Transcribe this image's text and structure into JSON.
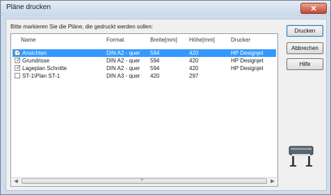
{
  "window": {
    "title": "Pläne drucken",
    "close_glyph": "✕"
  },
  "prompt": "Bitte markieren Sie die Pläne, die gedruckt werden sollen:",
  "columns": {
    "name": "Name",
    "format": "Format",
    "width": "Breite[mm]",
    "height": "Höhe[mm]",
    "printer": "Drucker"
  },
  "rows": [
    {
      "checked": true,
      "selected": true,
      "name": "Ansichten",
      "format": "DIN A2 - quer",
      "width": "594",
      "height": "420",
      "printer": "HP Designjet"
    },
    {
      "checked": true,
      "selected": false,
      "name": "Grundrisse",
      "format": "DIN A2 - quer",
      "width": "594",
      "height": "420",
      "printer": "HP Designjet"
    },
    {
      "checked": true,
      "selected": false,
      "name": "Lageplan Schnitte",
      "format": "DIN A2 - quer",
      "width": "594",
      "height": "420",
      "printer": "HP Designjet"
    },
    {
      "checked": false,
      "selected": false,
      "name": "ST-1\\Plan ST-1",
      "format": "DIN A3 - quer",
      "width": "420",
      "height": "297",
      "printer": ""
    }
  ],
  "check_glyph": "✓",
  "scrollbar": {
    "left_arrow": "◀",
    "right_arrow": "▶",
    "grip": "≡"
  },
  "buttons": {
    "print": "Drucken",
    "cancel": "Abbrechen",
    "help": "Hilfe"
  },
  "colors": {
    "selection": "#3399ff",
    "title_bg": "#cfdcec"
  },
  "icons": {
    "plotter": "printer-plotter-icon"
  }
}
